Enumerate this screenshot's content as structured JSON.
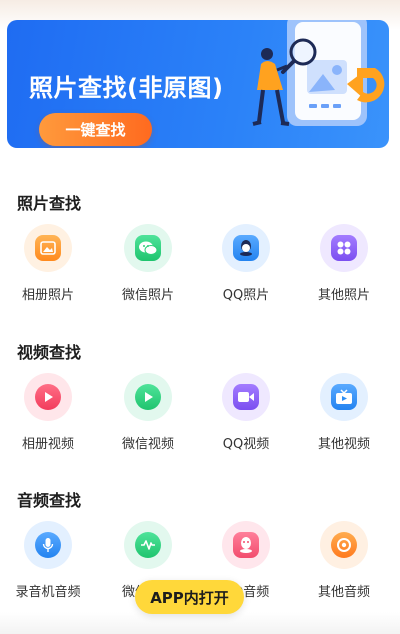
{
  "banner": {
    "title": "照片查找(非原图)",
    "button_label": "一键查找"
  },
  "sections": [
    {
      "title": "照片查找",
      "items": [
        {
          "label": "相册照片",
          "icon": "album-photo-icon",
          "color": "#ff9a3c"
        },
        {
          "label": "微信照片",
          "icon": "wechat-icon",
          "color": "#2fd07a"
        },
        {
          "label": "QQ照片",
          "icon": "qq-icon",
          "color": "#2e8ff5"
        },
        {
          "label": "其他照片",
          "icon": "grid-apps-icon",
          "color": "#8a5cf6"
        }
      ]
    },
    {
      "title": "视频查找",
      "items": [
        {
          "label": "相册视频",
          "icon": "album-video-icon",
          "color": "#ff4d6a"
        },
        {
          "label": "微信视频",
          "icon": "wechat-video-icon",
          "color": "#2fd07a"
        },
        {
          "label": "QQ视频",
          "icon": "qq-video-icon",
          "color": "#8a5cf6"
        },
        {
          "label": "其他视频",
          "icon": "tv-video-icon",
          "color": "#2e8ff5"
        }
      ]
    },
    {
      "title": "音频查找",
      "items": [
        {
          "label": "录音机音频",
          "icon": "microphone-icon",
          "color": "#2e8ff5"
        },
        {
          "label": "微信音频",
          "icon": "wechat-audio-icon",
          "color": "#2fd07a"
        },
        {
          "label": "QQ音频",
          "icon": "qq-audio-icon",
          "color": "#ff5a7a"
        },
        {
          "label": "其他音频",
          "icon": "audio-disc-icon",
          "color": "#ff8a2a"
        }
      ]
    }
  ],
  "floating_button": {
    "label": "APP内打开"
  }
}
